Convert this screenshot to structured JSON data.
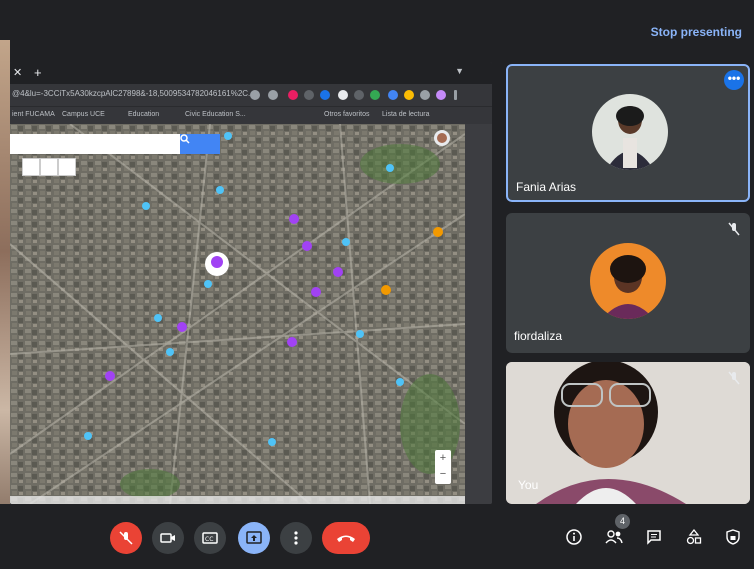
{
  "header": {
    "stop_presenting_label": "Stop presenting"
  },
  "browser": {
    "url_text": "@4&lu=-3CCiTx5A30kzcpAlC27898&-18,5009534782046161%2C...",
    "bookmarks": [
      "ient FUCAMA",
      "Campus UCE",
      "Education",
      "Civic Education S...",
      "Otros favoritos",
      "Lista de lectura"
    ]
  },
  "participants": [
    {
      "name": "Fania Arias",
      "active": true
    },
    {
      "name": "fiordaliza",
      "muted": true
    },
    {
      "name": "You",
      "muted": true
    }
  ],
  "controls": {
    "participants_count": "4"
  },
  "colors": {
    "accent": "#8ab4f8",
    "danger": "#ea4335",
    "background": "#202124"
  },
  "icons": [
    "mic-off-icon",
    "videocam-icon",
    "captions-icon",
    "present-icon",
    "more-vert-icon",
    "call-end-icon",
    "info-icon",
    "people-icon",
    "chat-icon",
    "activities-icon",
    "host-controls-icon"
  ]
}
